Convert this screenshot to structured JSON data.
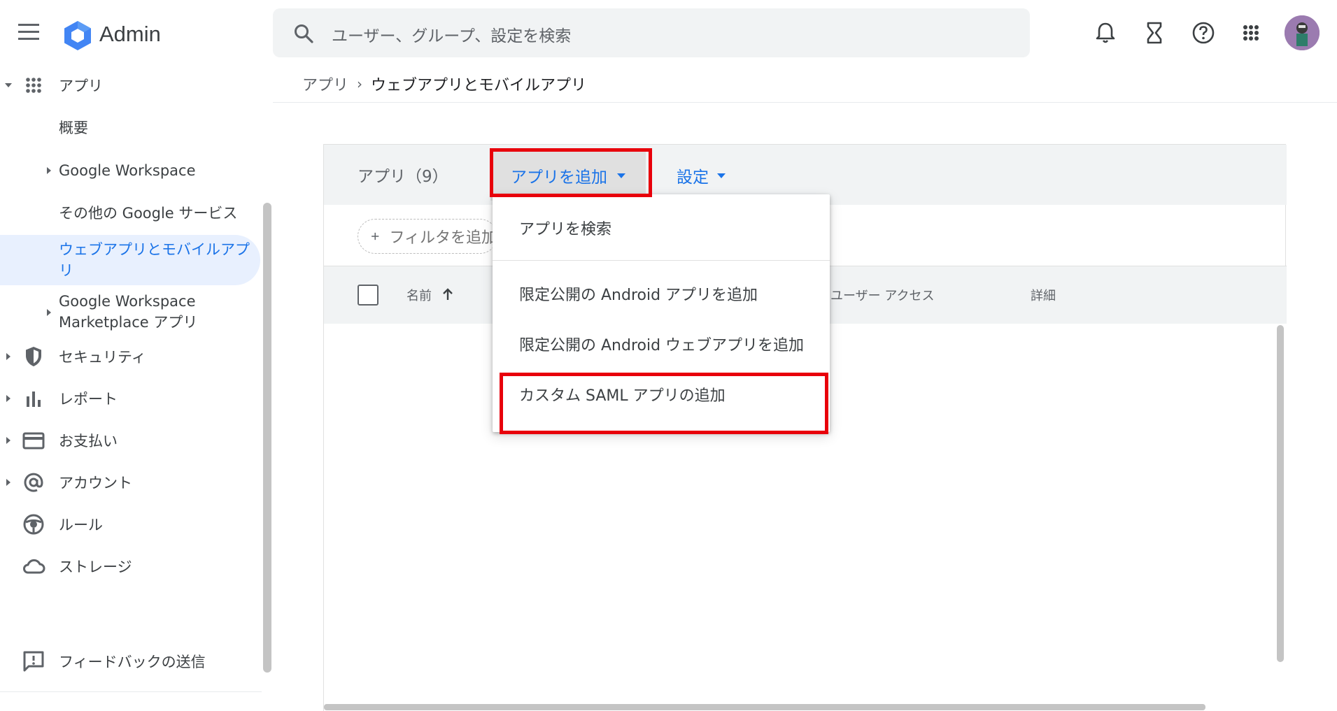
{
  "header": {
    "brand": "Admin",
    "search_placeholder": "ユーザー、グループ、設定を検索",
    "icons": [
      "menu-icon",
      "admin-logo",
      "search-icon",
      "bell-icon",
      "hourglass-icon",
      "help-icon",
      "apps-grid-icon",
      "avatar"
    ]
  },
  "breadcrumb": {
    "parent": "アプリ",
    "separator": "›",
    "current": "ウェブアプリとモバイルアプリ"
  },
  "sidebar": {
    "section": "アプリ",
    "sub_items": [
      {
        "label": "概要"
      },
      {
        "label": "Google Workspace"
      },
      {
        "label": "その他の Google サービス"
      },
      {
        "label_line1": "ウェブアプリとモバイルアプ",
        "label_line2": "リ",
        "active": true
      },
      {
        "label_line1": "Google Workspace",
        "label_line2": "Marketplace アプリ"
      }
    ],
    "items": [
      {
        "label": "セキュリティ",
        "icon": "shield-icon"
      },
      {
        "label": "レポート",
        "icon": "bar-chart-icon"
      },
      {
        "label": "お支払い",
        "icon": "credit-card-icon"
      },
      {
        "label": "アカウント",
        "icon": "at-sign-icon"
      },
      {
        "label": "ルール",
        "icon": "rules-icon"
      },
      {
        "label": "ストレージ",
        "icon": "cloud-icon"
      }
    ],
    "feedback": "フィードバックの送信"
  },
  "card": {
    "apps_count": "アプリ（9）",
    "add_app": "アプリを追加",
    "settings": "設定",
    "filter": "フィルタを追加",
    "columns": {
      "name": "名前",
      "user_access": "ユーザー アクセス",
      "details": "詳細"
    }
  },
  "menu": {
    "items": [
      "アプリを検索",
      "限定公開の Android アプリを追加",
      "限定公開の Android ウェブアプリを追加",
      "カスタム SAML アプリの追加"
    ]
  },
  "colors": {
    "accent": "#1a73e8",
    "highlight": "#e8000b",
    "header_bg": "#f1f3f4"
  }
}
